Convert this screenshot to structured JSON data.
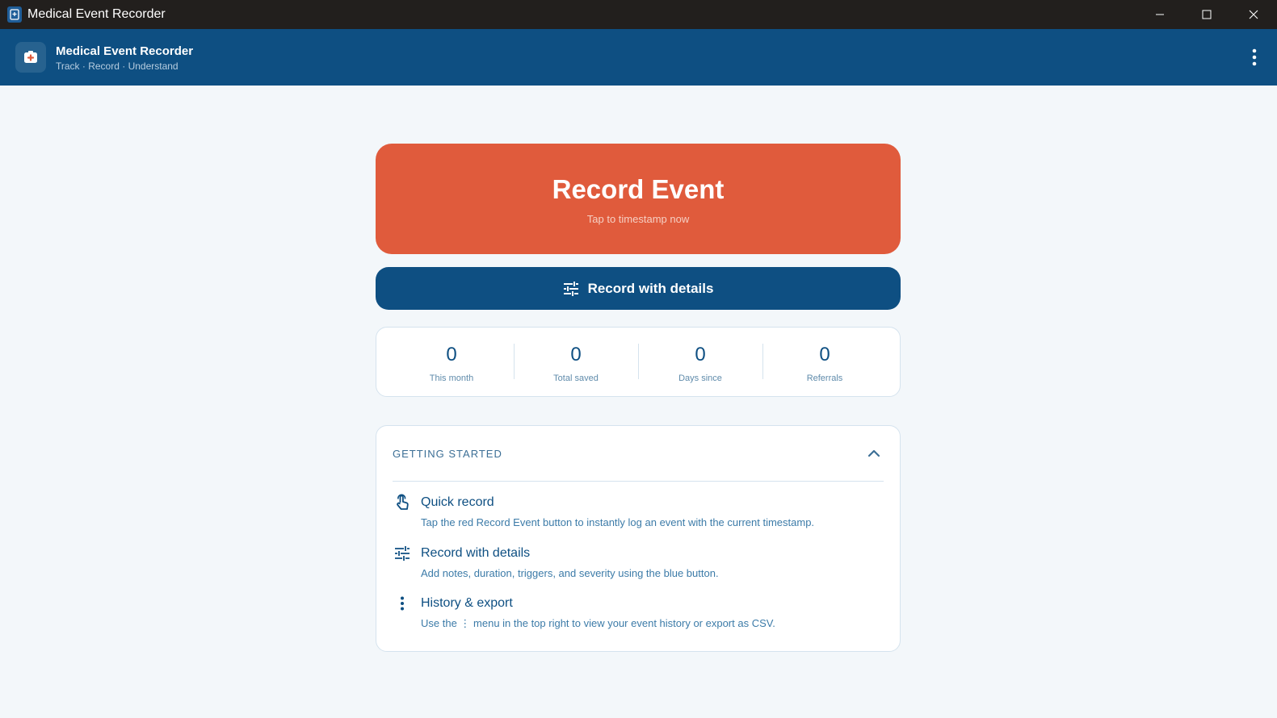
{
  "window": {
    "title": "Medical Event Recorder"
  },
  "header": {
    "app_name": "Medical Event Recorder",
    "tagline": "Track · Record · Understand"
  },
  "record_button": {
    "title": "Record Event",
    "subtitle": "Tap to timestamp now"
  },
  "details_button": {
    "label": "Record with details"
  },
  "stats": [
    {
      "value": "0",
      "label": "This month"
    },
    {
      "value": "0",
      "label": "Total saved"
    },
    {
      "value": "0",
      "label": "Days since"
    },
    {
      "value": "0",
      "label": "Referrals"
    }
  ],
  "getting_started": {
    "heading": "GETTING STARTED",
    "items": [
      {
        "icon": "touch-icon",
        "title": "Quick record",
        "description": "Tap the red Record Event button to instantly log an event with the current timestamp."
      },
      {
        "icon": "tune-icon",
        "title": "Record with details",
        "description": "Add notes, duration, triggers, and severity using the blue button."
      },
      {
        "icon": "more-vert-icon",
        "title": "History & export",
        "description": "Use the ⋮ menu in the top right to view your event history or export as CSV."
      }
    ]
  },
  "colors": {
    "primary": "#0e4f82",
    "accent": "#e05b3c",
    "background": "#f3f7fa",
    "titlebar": "#221f1d"
  }
}
